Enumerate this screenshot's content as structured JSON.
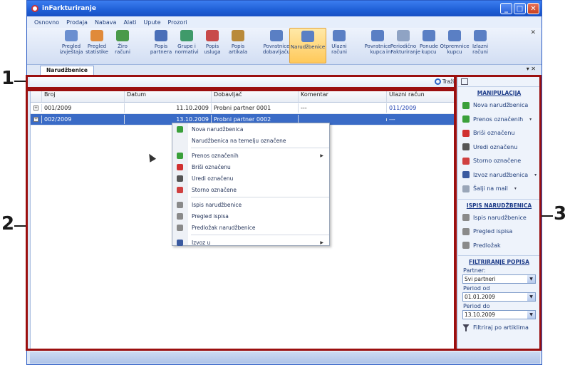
{
  "window": {
    "title": "inFarkturiranje",
    "buttons": [
      "_",
      "□",
      "✕"
    ]
  },
  "menu": [
    "Osnovno",
    "Prodaja",
    "Nabava",
    "Alati",
    "Upute",
    "Prozori"
  ],
  "ribbon": {
    "buttons": [
      {
        "label": "Pregled izvještaja",
        "icon": "report-icon",
        "color": "#6b8fd0"
      },
      {
        "label": "Pregled statistike",
        "icon": "chart-icon",
        "color": "#e08a3a"
      },
      {
        "label": "Žiro računi",
        "icon": "bank-icon",
        "color": "#4a9a4a"
      },
      {
        "label": "Popis partnera",
        "icon": "partners-icon",
        "color": "#4a6fb8"
      },
      {
        "label": "Grupe i normativi",
        "icon": "groups-icon",
        "color": "#3f9a6a"
      },
      {
        "label": "Popis usluga",
        "icon": "services-icon",
        "color": "#c84a4a"
      },
      {
        "label": "Popis artikala",
        "icon": "items-icon",
        "color": "#b98a3a"
      },
      {
        "label": "Povratnice dobavljaču",
        "icon": "return-icon",
        "color": "#5a7fc4"
      },
      {
        "label": "Narudžbenice",
        "icon": "order-icon",
        "color": "#5a7fc4",
        "selected": true
      },
      {
        "label": "Ulazni računi",
        "icon": "incoming-invoice-icon",
        "color": "#5a7fc4"
      },
      {
        "label": "Povratnice kupca",
        "icon": "customer-return-icon",
        "color": "#5a7fc4"
      },
      {
        "label": "Periodično inFakturiranje",
        "icon": "periodic-icon",
        "color": "#8fa3c4"
      },
      {
        "label": "Ponude kupcu",
        "icon": "offer-icon",
        "color": "#5a7fc4"
      },
      {
        "label": "Otpremnice kupcu",
        "icon": "delivery-icon",
        "color": "#5a7fc4"
      },
      {
        "label": "Izlazni računi",
        "icon": "outgoing-invoice-icon",
        "color": "#5a7fc4"
      }
    ],
    "close": "✕"
  },
  "tab": {
    "label": "Narudžbenice",
    "controls": "▾ ✕"
  },
  "search": {
    "label": "Traži"
  },
  "grid": {
    "columns": [
      "Broj",
      "Datum",
      "Dobavljač",
      "Komentar",
      "Ulazni račun"
    ],
    "rows": [
      {
        "broj": "001/2009",
        "datum": "11.10.2009",
        "dobavljac": "Probni partner 0001",
        "komentar": "---",
        "racun": "011/2009"
      },
      {
        "broj": "002/2009",
        "datum": "13.10.2009",
        "dobavljac": "Probni partner 0002",
        "komentar": "",
        "racun": "---"
      }
    ]
  },
  "context_menu": [
    {
      "label": "Nova narudžbenica",
      "icon": "new-icon",
      "color": "#3aa03a"
    },
    {
      "label": "Narudžbenica na temelju označene",
      "icon": "",
      "color": ""
    },
    {
      "sep": true
    },
    {
      "label": "Prenos označenih",
      "icon": "transfer-icon",
      "color": "#3aa03a",
      "submenu": true
    },
    {
      "label": "Briši označenu",
      "icon": "delete-icon",
      "color": "#d03030"
    },
    {
      "label": "Uredi označenu",
      "icon": "edit-icon",
      "color": "#555555"
    },
    {
      "label": "Storno označene",
      "icon": "cancel-icon",
      "color": "#d04040"
    },
    {
      "sep": true
    },
    {
      "label": "Ispis narudžbenice",
      "icon": "print-icon",
      "color": "#8a8a8a"
    },
    {
      "label": "Pregled ispisa",
      "icon": "preview-icon",
      "color": "#8a8a8a"
    },
    {
      "label": "Predložak narudžbenice",
      "icon": "template-icon",
      "color": "#8a8a8a"
    },
    {
      "sep": true
    },
    {
      "label": "Izvoz u",
      "icon": "export-icon",
      "color": "#3a5aa0",
      "submenu": true
    }
  ],
  "panel": {
    "manip_title": "MANIPULACIJA",
    "manip_items": [
      {
        "label": "Nova narudžbenica",
        "icon": "new-icon",
        "color": "#3aa03a"
      },
      {
        "label": "Prenos označenih",
        "icon": "transfer-icon",
        "color": "#3aa03a",
        "dropdown": true
      },
      {
        "label": "Briši označenu",
        "icon": "delete-icon",
        "color": "#d03030"
      },
      {
        "label": "Uredi označenu",
        "icon": "edit-icon",
        "color": "#555555"
      },
      {
        "label": "Storno označene",
        "icon": "cancel-icon",
        "color": "#d04040"
      },
      {
        "label": "Izvoz narudžbenica",
        "icon": "export-icon",
        "color": "#3a5aa0",
        "dropdown": true
      },
      {
        "label": "Šalji na mail",
        "icon": "mail-icon",
        "color": "#9aa6b8",
        "dropdown": true
      }
    ],
    "print_title": "ISPIS NARUDŽBENICA",
    "print_items": [
      {
        "label": "Ispis narudžbenice",
        "icon": "print-icon",
        "color": "#8a8a8a"
      },
      {
        "label": "Pregled ispisa",
        "icon": "preview-icon",
        "color": "#8a8a8a"
      },
      {
        "label": "Predložak",
        "icon": "template-icon",
        "color": "#8a8a8a"
      }
    ],
    "filter_title": "FILTRIRANJE POPISA",
    "partner_label": "Partner:",
    "partner_value": "Svi partneri",
    "from_label": "Period od",
    "from_value": "01.01.2009",
    "to_label": "Period do",
    "to_value": "13.10.2009",
    "filter_items_label": "Filtriraj po artiklima"
  },
  "annotations": [
    "1",
    "2",
    "3"
  ]
}
